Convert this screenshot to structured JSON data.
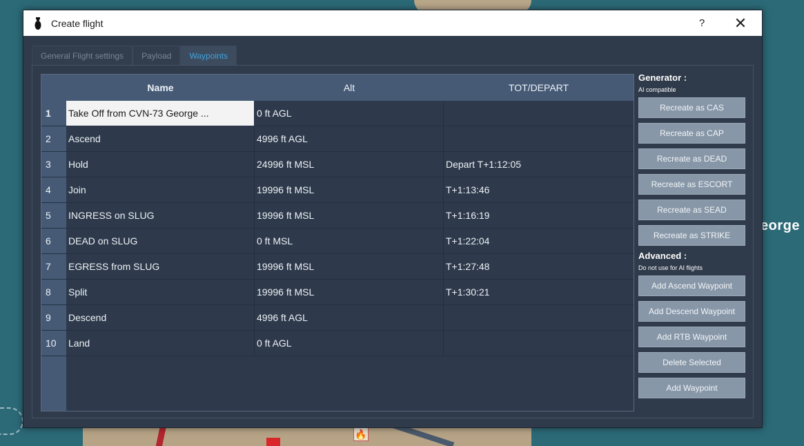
{
  "window": {
    "title": "Create flight",
    "help_label": "?",
    "close_label": "✕"
  },
  "tabs": [
    {
      "label": "General Flight settings",
      "active": false
    },
    {
      "label": "Payload",
      "active": false
    },
    {
      "label": "Waypoints",
      "active": true
    }
  ],
  "table": {
    "columns": [
      "Name",
      "Alt",
      "TOT/DEPART"
    ],
    "rows": [
      {
        "num": "1",
        "name": "Take Off from CVN-73 George ...",
        "alt": "0 ft AGL",
        "tot": ""
      },
      {
        "num": "2",
        "name": "Ascend",
        "alt": "4996 ft AGL",
        "tot": ""
      },
      {
        "num": "3",
        "name": "Hold",
        "alt": "24996 ft MSL",
        "tot": "Depart T+1:12:05"
      },
      {
        "num": "4",
        "name": "Join",
        "alt": "19996 ft MSL",
        "tot": "T+1:13:46"
      },
      {
        "num": "5",
        "name": "INGRESS on SLUG",
        "alt": "19996 ft MSL",
        "tot": "T+1:16:19"
      },
      {
        "num": "6",
        "name": "DEAD on SLUG",
        "alt": "0 ft MSL",
        "tot": "T+1:22:04"
      },
      {
        "num": "7",
        "name": "EGRESS from SLUG",
        "alt": "19996 ft MSL",
        "tot": "T+1:27:48"
      },
      {
        "num": "8",
        "name": "Split",
        "alt": "19996 ft MSL",
        "tot": "T+1:30:21"
      },
      {
        "num": "9",
        "name": "Descend",
        "alt": "4996 ft AGL",
        "tot": ""
      },
      {
        "num": "10",
        "name": "Land",
        "alt": "0 ft AGL",
        "tot": ""
      }
    ]
  },
  "generator": {
    "title": "Generator :",
    "subtitle": "AI compatible",
    "buttons": [
      "Recreate as CAS",
      "Recreate as CAP",
      "Recreate as DEAD",
      "Recreate as ESCORT",
      "Recreate as SEAD",
      "Recreate as STRIKE"
    ]
  },
  "advanced": {
    "title": "Advanced :",
    "subtitle": "Do not use for AI flights",
    "buttons": [
      "Add Ascend Waypoint",
      "Add Descend Waypoint",
      "Add RTB Waypoint",
      "Delete Selected",
      "Add Waypoint"
    ]
  },
  "map": {
    "label": "eorge"
  },
  "icons": {
    "window": "bomb-icon",
    "close": "close-icon",
    "help": "help-icon",
    "map_marker": "fire-icon"
  },
  "colors": {
    "accent_tab": "#3fa4dd",
    "header_bg": "#465a76",
    "button_bg": "#8797a8",
    "panel_bg": "#2f3a4a"
  }
}
